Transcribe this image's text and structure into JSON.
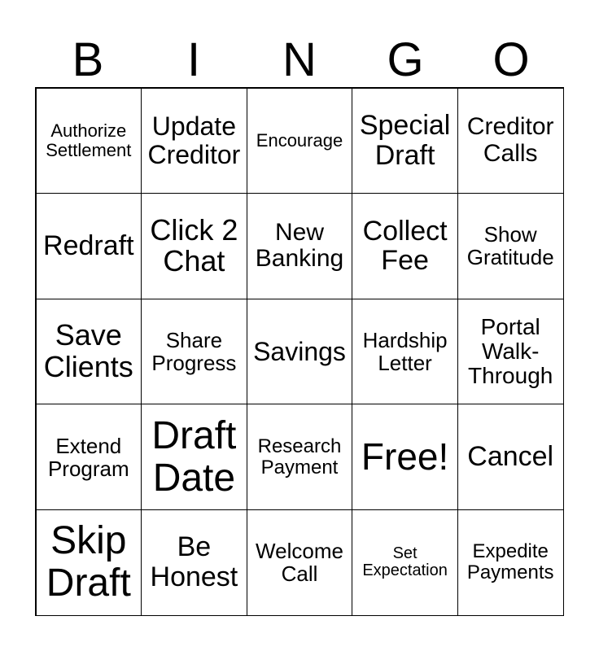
{
  "header": [
    "B",
    "I",
    "N",
    "G",
    "O"
  ],
  "cells": [
    [
      "Authorize\nSettlement",
      "Update\nCreditor",
      "Encourage",
      "Special\nDraft",
      "Creditor\nCalls"
    ],
    [
      "Redraft",
      "Click 2\nChat",
      "New\nBanking",
      "Collect\nFee",
      "Show\nGratitude"
    ],
    [
      "Save\nClients",
      "Share\nProgress",
      "Savings",
      "Hardship\nLetter",
      "Portal\nWalk-\nThrough"
    ],
    [
      "Extend\nProgram",
      "Draft\nDate",
      "Research\nPayment",
      "Free!",
      "Cancel"
    ],
    [
      "Skip\nDraft",
      "Be\nHonest",
      "Welcome\nCall",
      "Set\nExpectation",
      "Expedite\nPayments"
    ]
  ]
}
